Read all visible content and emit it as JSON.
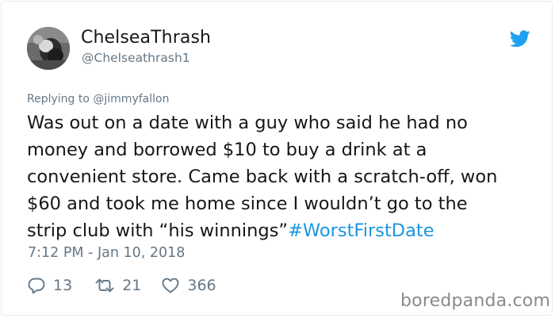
{
  "author": {
    "display_name": "ChelseaThrash",
    "handle": "@Chelseathrash1"
  },
  "reply": {
    "prefix": "Replying to",
    "mention": "@jimmyfallon"
  },
  "tweet": {
    "lines": [
      "Was out on a date with a guy who said he had no",
      "money and borrowed $10 to buy a drink at a",
      "convenient store. Came back with a scratch-off, won",
      "$60 and took me home since I wouldn’t go to the"
    ],
    "last_line": "strip club with “his winnings”",
    "hashtag": "#WorstFirstDate"
  },
  "timestamp": "7:12 PM - Jan 10, 2018",
  "stats": {
    "replies": "13",
    "retweets": "21",
    "likes": "366"
  },
  "watermark": "boredpanda.com",
  "colors": {
    "text": "#14171a",
    "secondary": "#657786",
    "link": "#1b95e0",
    "twitter_blue": "#1da1f2",
    "border": "#e6ecf0"
  },
  "icons": [
    "twitter-bird-icon",
    "reply-icon",
    "retweet-icon",
    "like-icon"
  ]
}
